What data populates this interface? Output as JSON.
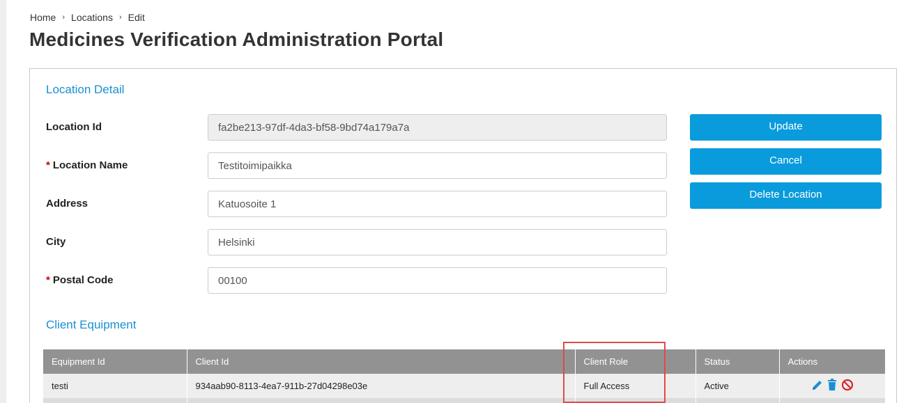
{
  "breadcrumb": {
    "home": "Home",
    "locations": "Locations",
    "edit": "Edit",
    "separator": "›"
  },
  "page": {
    "title": "Medicines Verification Administration Portal"
  },
  "location_detail": {
    "heading": "Location Detail",
    "required_marker": "*",
    "fields": {
      "location_id": {
        "label": "Location Id",
        "value": "fa2be213-97df-4da3-bf58-9bd74a179a7a"
      },
      "location_name": {
        "label": "Location Name",
        "value": "Testitoimipaikka"
      },
      "address": {
        "label": "Address",
        "value": "Katuosoite 1"
      },
      "city": {
        "label": "City",
        "value": "Helsinki"
      },
      "postal_code": {
        "label": "Postal Code",
        "value": "00100"
      }
    },
    "buttons": {
      "update": "Update",
      "cancel": "Cancel",
      "delete": "Delete Location"
    }
  },
  "client_equipment": {
    "heading": "Client Equipment",
    "columns": {
      "equipment_id": "Equipment Id",
      "client_id": "Client Id",
      "client_role": "Client Role",
      "status": "Status",
      "actions": "Actions"
    },
    "rows": [
      {
        "equipment_id": "testi",
        "client_id": "934aab90-8113-4ea7-911b-27d04298e03e",
        "client_role": "Full Access",
        "status": "Active"
      }
    ]
  },
  "colors": {
    "accent": "#0a9bdc",
    "heading": "#1a8fd2",
    "required": "#cc0000",
    "table_header": "#929292",
    "highlight": "#e0494b"
  },
  "icons": {
    "edit": "pencil-icon",
    "delete": "trash-icon",
    "disable": "ban-icon"
  }
}
